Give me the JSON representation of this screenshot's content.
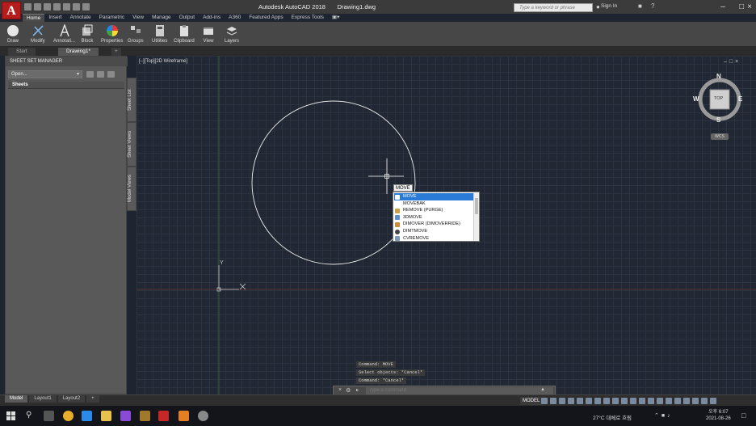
{
  "window": {
    "app_title": "Autodesk AutoCAD 2018",
    "file_title": "Drawing1.dwg",
    "search_placeholder": "Type a keyword or phrase",
    "signin_label": "Sign In"
  },
  "ribbon": {
    "tabs": [
      "Home",
      "Insert",
      "Annotate",
      "Parametric",
      "View",
      "Manage",
      "Output",
      "Add-ins",
      "A360",
      "Featured Apps",
      "Express Tools"
    ],
    "active_tab": "Home",
    "panels": [
      {
        "label": "Draw",
        "icon": "circle-draw-icon"
      },
      {
        "label": "Modify",
        "icon": "modify-icon"
      },
      {
        "label": "Annotati...",
        "icon": "text-a-icon"
      },
      {
        "label": "Block",
        "icon": "block-icon"
      },
      {
        "label": "Properties",
        "icon": "color-wheel-icon"
      },
      {
        "label": "Groups",
        "icon": "groups-icon"
      },
      {
        "label": "Utilities",
        "icon": "calculator-icon"
      },
      {
        "label": "Clipboard",
        "icon": "clipboard-icon"
      },
      {
        "label": "View",
        "icon": "view-icon"
      },
      {
        "label": "Layers",
        "icon": "layers-icon"
      }
    ]
  },
  "doc_tabs": [
    "Start",
    "Drawing1*"
  ],
  "doc_tab_add": "+",
  "palette": {
    "title": "SHEET SET MANAGER",
    "select_value": "Open...",
    "sheets_label": "Sheets",
    "side_tabs": [
      "Sheet List",
      "Sheet Views",
      "Model Views"
    ]
  },
  "viewport": {
    "label": "[–][Top][2D Wireframe]",
    "compass": {
      "n": "N",
      "s": "S",
      "e": "E",
      "w": "W",
      "face": "TOP"
    },
    "ucs": "WCS",
    "ucs_y_label": "Y"
  },
  "command": {
    "history": [
      "Command: MOVE",
      "Select objects: *Cancel*",
      "Command: *Cancel*"
    ],
    "echo": "MOVE",
    "placeholder": "Type a command"
  },
  "autocomplete": {
    "items": [
      "MOVE",
      "MOVEBAK",
      "REMOVE (PURGE)",
      "3DMOVE",
      "DIMOVER (DIMOVERRIDE)",
      "DIMTMOVE",
      "CVREMOVE"
    ],
    "selected_index": 0
  },
  "layout_tabs": [
    "Model",
    "Layout1",
    "Layout2",
    "+"
  ],
  "status": {
    "model_label": "MODEL"
  },
  "taskbar": {
    "weather": "27°C 대체로 흐림",
    "time": "오후 6:07",
    "date": "2021-08-26"
  },
  "colors": {
    "canvas_bg": "#212833",
    "accent": "#2a7ad8",
    "logo_red": "#b51c1c"
  }
}
